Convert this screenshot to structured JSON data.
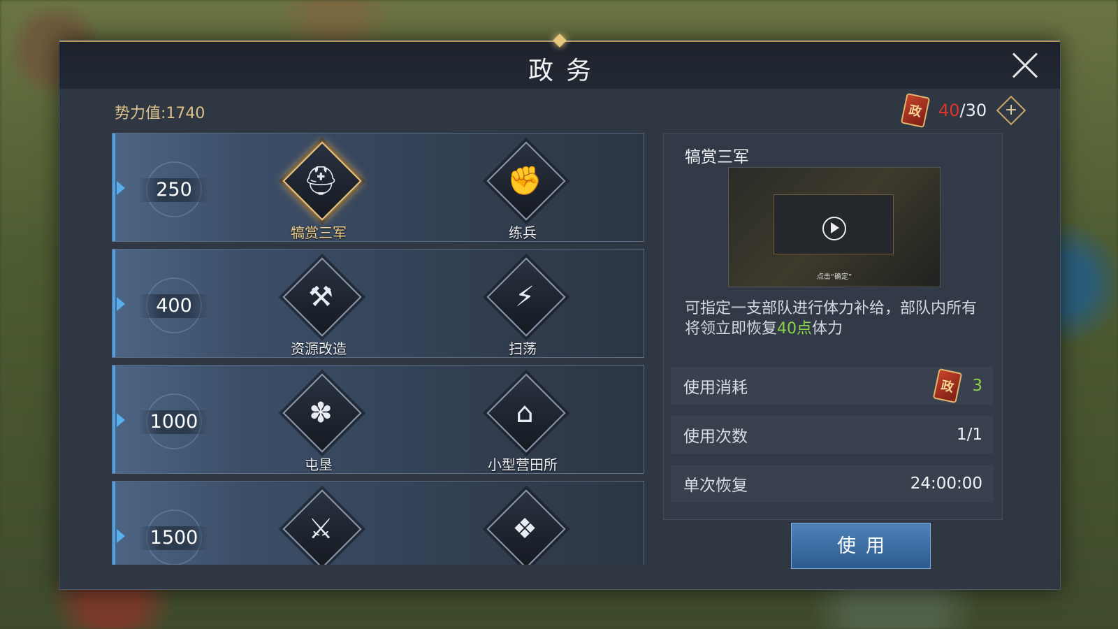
{
  "header": {
    "title": "政务"
  },
  "power": {
    "text": "势力值:1740"
  },
  "tokens": {
    "icon_char": "政",
    "current": "40",
    "separator": "/",
    "max": "30",
    "plus_icon": "plus-icon"
  },
  "rows": [
    {
      "level": "250",
      "skills": [
        {
          "name": "犒赏三军",
          "icon": "helmet-laurel-icon",
          "glyph": "⛑",
          "active": true
        },
        {
          "name": "练兵",
          "icon": "fist-shield-icon",
          "glyph": "✊"
        }
      ]
    },
    {
      "level": "400",
      "skills": [
        {
          "name": "资源改造",
          "icon": "anvil-hammer-icon",
          "glyph": "⚒"
        },
        {
          "name": "扫荡",
          "icon": "lightning-shield-icon",
          "glyph": "⚡"
        }
      ]
    },
    {
      "level": "1000",
      "skills": [
        {
          "name": "屯垦",
          "icon": "wheat-icon",
          "glyph": "✽"
        },
        {
          "name": "小型营田所",
          "icon": "farmhouse-icon",
          "glyph": "⌂"
        }
      ]
    },
    {
      "level": "1500",
      "skills": [
        {
          "name": "",
          "icon": "crossed-swords-helmet-icon",
          "glyph": "⚔"
        },
        {
          "name": "",
          "icon": "resource-bundle-icon",
          "glyph": "❖"
        }
      ]
    }
  ],
  "detail": {
    "name": "犒赏三军",
    "video_caption": "点击“确定”",
    "desc_before": "可指定一支部队进行体力补给，部队内所有将领立即恢复",
    "desc_highlight": "40点",
    "desc_after": "体力",
    "stats": [
      {
        "label": "使用消耗",
        "value": "3"
      },
      {
        "label": "使用次数",
        "value": "1/1"
      },
      {
        "label": "单次恢复",
        "value": "24:00:00"
      }
    ]
  },
  "use_button": {
    "label": "使用"
  },
  "colors": {
    "accent_gold": "#dcc08a",
    "count_red": "#e0352e",
    "highlight_green": "#8bd24a",
    "row_edge_blue": "#4ea2e6"
  }
}
